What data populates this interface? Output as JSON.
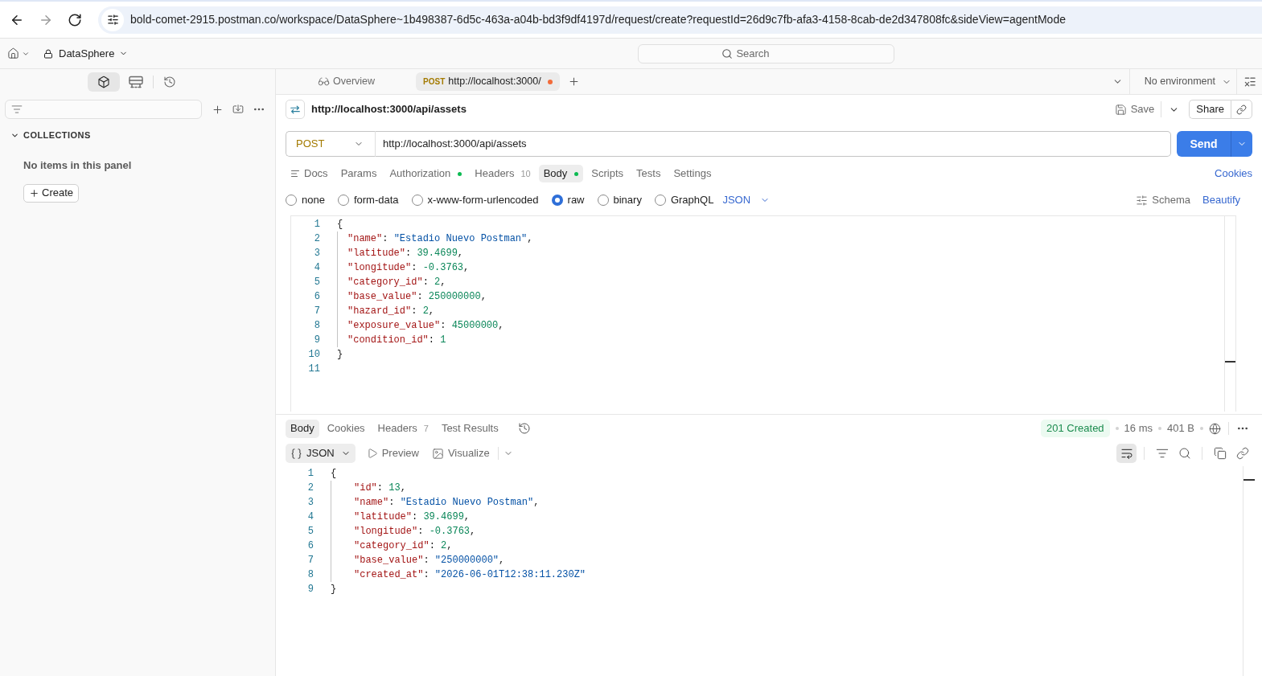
{
  "browser": {
    "url": "bold-comet-2915.postman.co/workspace/DataSphere~1b498387-6d5c-463a-a04b-bd3f9df4197d/request/create?requestId=26d9c7fb-afa3-4158-8cab-de2d347808fc&sideView=agentMode"
  },
  "header": {
    "workspace": "DataSphere",
    "search": {
      "placeholder": "Search"
    }
  },
  "sidebar": {
    "views": [
      {
        "kind": "collections",
        "selected": true
      },
      {
        "kind": "flows",
        "selected": false
      },
      {
        "kind": "history",
        "selected": false
      }
    ],
    "section": {
      "title": "COLLECTIONS",
      "expanded": true
    },
    "empty_text": "No items in this panel",
    "create_button": "Create"
  },
  "tabs": [
    {
      "kind": "overview",
      "label": "Overview",
      "selected": false,
      "unsaved": false
    },
    {
      "kind": "request",
      "method": "POST",
      "label": "http://localhost:3000/",
      "selected": true,
      "unsaved": true
    }
  ],
  "environment": "No environment",
  "request": {
    "title": "http://localhost:3000/api/assets",
    "save": "Save",
    "share": "Share",
    "method": "POST",
    "url": "http://localhost:3000/api/assets",
    "send": "Send",
    "tabs": [
      {
        "kind": "docs",
        "label": "Docs",
        "selected": false,
        "indicator": false
      },
      {
        "kind": "tab",
        "label": "Params",
        "selected": false,
        "indicator": false
      },
      {
        "kind": "tab",
        "label": "Authorization",
        "selected": false,
        "indicator": true
      },
      {
        "kind": "tab",
        "label": "Headers",
        "count": "10",
        "selected": false,
        "indicator": false
      },
      {
        "kind": "tab",
        "label": "Body",
        "selected": true,
        "indicator": true
      },
      {
        "kind": "tab",
        "label": "Scripts",
        "selected": false,
        "indicator": false
      },
      {
        "kind": "tab",
        "label": "Tests",
        "selected": false,
        "indicator": false
      },
      {
        "kind": "tab",
        "label": "Settings",
        "selected": false,
        "indicator": false
      }
    ],
    "cookies": "Cookies",
    "body_types": [
      {
        "label": "none",
        "selected": false
      },
      {
        "label": "form-data",
        "selected": false
      },
      {
        "label": "x-www-form-urlencoded",
        "selected": false
      },
      {
        "label": "raw",
        "selected": true
      },
      {
        "label": "binary",
        "selected": false
      },
      {
        "label": "GraphQL",
        "selected": false
      }
    ],
    "format": "JSON",
    "schema": "Schema",
    "beautify": "Beautify",
    "code": [
      {
        "number": "1",
        "indented": false,
        "tokens": [
          {
            "kind": "punct",
            "text": "{"
          }
        ]
      },
      {
        "number": "2",
        "indented": true,
        "tokens": [
          {
            "kind": "key",
            "text": "\"name\""
          },
          {
            "kind": "punct",
            "text": ": "
          },
          {
            "kind": "string",
            "text": "\"Estadio Nuevo Postman\""
          },
          {
            "kind": "punct",
            "text": ","
          }
        ]
      },
      {
        "number": "3",
        "indented": true,
        "tokens": [
          {
            "kind": "key",
            "text": "\"latitude\""
          },
          {
            "kind": "punct",
            "text": ": "
          },
          {
            "kind": "number",
            "text": "39.4699"
          },
          {
            "kind": "punct",
            "text": ","
          }
        ]
      },
      {
        "number": "4",
        "indented": true,
        "tokens": [
          {
            "kind": "key",
            "text": "\"longitude\""
          },
          {
            "kind": "punct",
            "text": ": "
          },
          {
            "kind": "number",
            "text": "-0.3763"
          },
          {
            "kind": "punct",
            "text": ","
          }
        ]
      },
      {
        "number": "5",
        "indented": true,
        "tokens": [
          {
            "kind": "key",
            "text": "\"category_id\""
          },
          {
            "kind": "punct",
            "text": ": "
          },
          {
            "kind": "number",
            "text": "2"
          },
          {
            "kind": "punct",
            "text": ","
          }
        ]
      },
      {
        "number": "6",
        "indented": true,
        "tokens": [
          {
            "kind": "key",
            "text": "\"base_value\""
          },
          {
            "kind": "punct",
            "text": ": "
          },
          {
            "kind": "number",
            "text": "250000000"
          },
          {
            "kind": "punct",
            "text": ","
          }
        ]
      },
      {
        "number": "7",
        "indented": true,
        "tokens": [
          {
            "kind": "key",
            "text": "\"hazard_id\""
          },
          {
            "kind": "punct",
            "text": ": "
          },
          {
            "kind": "number",
            "text": "2"
          },
          {
            "kind": "punct",
            "text": ","
          }
        ]
      },
      {
        "number": "8",
        "indented": true,
        "tokens": [
          {
            "kind": "key",
            "text": "\"exposure_value\""
          },
          {
            "kind": "punct",
            "text": ": "
          },
          {
            "kind": "number",
            "text": "45000000"
          },
          {
            "kind": "punct",
            "text": ","
          }
        ]
      },
      {
        "number": "9",
        "indented": true,
        "tokens": [
          {
            "kind": "key",
            "text": "\"condition_id\""
          },
          {
            "kind": "punct",
            "text": ": "
          },
          {
            "kind": "number",
            "text": "1"
          }
        ]
      },
      {
        "number": "10",
        "indented": false,
        "tokens": [
          {
            "kind": "punct",
            "text": "}"
          }
        ]
      },
      {
        "number": "11",
        "indented": false
      }
    ]
  },
  "response": {
    "tabs": [
      {
        "label": "Body",
        "selected": true
      },
      {
        "label": "Cookies",
        "selected": false
      },
      {
        "label": "Headers",
        "count": "7",
        "selected": false
      },
      {
        "label": "Test Results",
        "selected": false
      }
    ],
    "status": "201 Created",
    "time": "16 ms",
    "size": "401 B",
    "view": "JSON",
    "preview": "Preview",
    "visualize": "Visualize",
    "toolbar": [
      {
        "kind": "wrap",
        "selected": true
      },
      {
        "kind": "filter",
        "selected": false
      },
      {
        "kind": "search",
        "selected": false
      },
      {
        "kind": "copy",
        "selected": false
      },
      {
        "kind": "link",
        "selected": false
      }
    ],
    "code": [
      {
        "number": "1",
        "indented": false,
        "tokens": [
          {
            "kind": "punct",
            "text": "{"
          }
        ]
      },
      {
        "number": "2",
        "indented": true,
        "tokens": [
          {
            "kind": "key",
            "text": "\"id\""
          },
          {
            "kind": "punct",
            "text": ": "
          },
          {
            "kind": "number",
            "text": "13"
          },
          {
            "kind": "punct",
            "text": ","
          }
        ]
      },
      {
        "number": "3",
        "indented": true,
        "tokens": [
          {
            "kind": "key",
            "text": "\"name\""
          },
          {
            "kind": "punct",
            "text": ": "
          },
          {
            "kind": "string",
            "text": "\"Estadio Nuevo Postman\""
          },
          {
            "kind": "punct",
            "text": ","
          }
        ]
      },
      {
        "number": "4",
        "indented": true,
        "tokens": [
          {
            "kind": "key",
            "text": "\"latitude\""
          },
          {
            "kind": "punct",
            "text": ": "
          },
          {
            "kind": "number",
            "text": "39.4699"
          },
          {
            "kind": "punct",
            "text": ","
          }
        ]
      },
      {
        "number": "5",
        "indented": true,
        "tokens": [
          {
            "kind": "key",
            "text": "\"longitude\""
          },
          {
            "kind": "punct",
            "text": ": "
          },
          {
            "kind": "number",
            "text": "-0.3763"
          },
          {
            "kind": "punct",
            "text": ","
          }
        ]
      },
      {
        "number": "6",
        "indented": true,
        "tokens": [
          {
            "kind": "key",
            "text": "\"category_id\""
          },
          {
            "kind": "punct",
            "text": ": "
          },
          {
            "kind": "number",
            "text": "2"
          },
          {
            "kind": "punct",
            "text": ","
          }
        ]
      },
      {
        "number": "7",
        "indented": true,
        "tokens": [
          {
            "kind": "key",
            "text": "\"base_value\""
          },
          {
            "kind": "punct",
            "text": ": "
          },
          {
            "kind": "string",
            "text": "\"250000000\""
          },
          {
            "kind": "punct",
            "text": ","
          }
        ]
      },
      {
        "number": "8",
        "indented": true,
        "tokens": [
          {
            "kind": "key",
            "text": "\"created_at\""
          },
          {
            "kind": "punct",
            "text": ": "
          },
          {
            "kind": "string",
            "text": "\"2026-06-01T12:38:11.230Z\""
          }
        ]
      },
      {
        "number": "9",
        "indented": false,
        "tokens": [
          {
            "kind": "punct",
            "text": "}"
          }
        ]
      }
    ]
  }
}
